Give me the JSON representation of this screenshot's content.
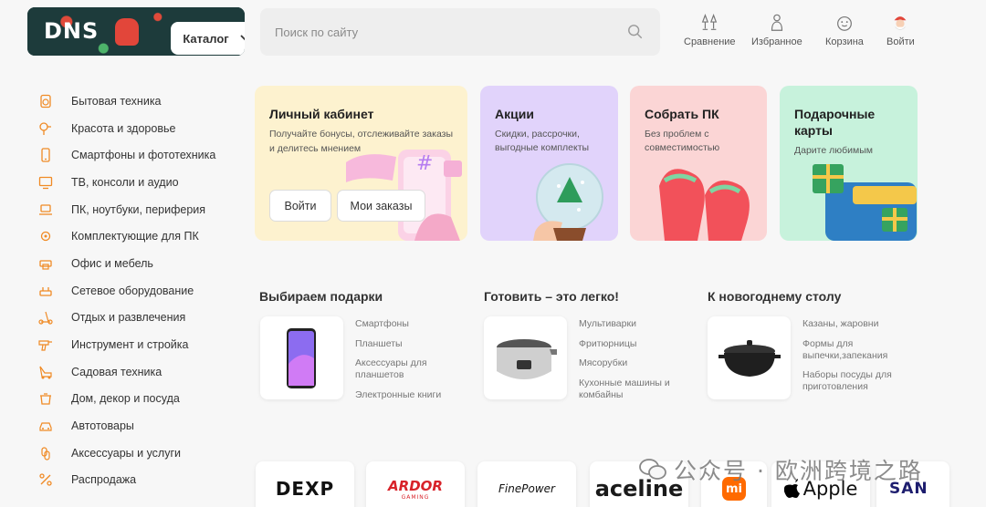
{
  "header": {
    "logo": "DNS",
    "catalog_label": "Каталог",
    "search_placeholder": "Поиск по сайту",
    "actions": [
      {
        "label": "Сравнение",
        "icon": "compare-icon"
      },
      {
        "label": "Избранное",
        "icon": "favorite-icon"
      },
      {
        "label": "Корзина",
        "icon": "cart-icon"
      },
      {
        "label": "Войти",
        "icon": "user-icon"
      }
    ]
  },
  "sidebar": {
    "items": [
      {
        "label": "Бытовая техника",
        "icon": "appliance-icon"
      },
      {
        "label": "Красота и здоровье",
        "icon": "hairdryer-icon"
      },
      {
        "label": "Смартфоны и фототехника",
        "icon": "smartphone-icon"
      },
      {
        "label": "ТВ, консоли и аудио",
        "icon": "tv-icon"
      },
      {
        "label": "ПК, ноутбуки, периферия",
        "icon": "laptop-icon"
      },
      {
        "label": "Комплектующие для ПК",
        "icon": "chip-icon"
      },
      {
        "label": "Офис и мебель",
        "icon": "printer-icon"
      },
      {
        "label": "Сетевое оборудование",
        "icon": "router-icon"
      },
      {
        "label": "Отдых и развлечения",
        "icon": "scooter-icon"
      },
      {
        "label": "Инструмент и стройка",
        "icon": "drill-icon"
      },
      {
        "label": "Садовая техника",
        "icon": "mower-icon"
      },
      {
        "label": "Дом, декор и посуда",
        "icon": "pot-icon"
      },
      {
        "label": "Автотовары",
        "icon": "car-icon"
      },
      {
        "label": "Аксессуары и услуги",
        "icon": "accessory-icon"
      },
      {
        "label": "Распродажа",
        "icon": "percent-icon"
      }
    ]
  },
  "promos": {
    "account": {
      "title": "Личный кабинет",
      "subtitle_1": "Получайте бонусы, отслеживайте заказы",
      "subtitle_2": "и делитесь мнением",
      "login_btn": "Войти",
      "orders_btn": "Мои заказы",
      "color": "#fdf3cf"
    },
    "sales": {
      "title": "Акции",
      "subtitle_1": "Скидки, рассрочки,",
      "subtitle_2": "выгодные комплекты",
      "color": "#e3d4fb"
    },
    "build_pc": {
      "title": "Собрать ПК",
      "subtitle_1": "Без проблем с",
      "subtitle_2": "совместимостью",
      "color": "#fbd6d6"
    },
    "gift_cards": {
      "title_1": "Подарочные",
      "title_2": "карты",
      "subtitle_1": "Дарите любимым",
      "color": "#c9f3dd"
    }
  },
  "sections": [
    {
      "title": "Выбираем подарки",
      "links": [
        "Смартфоны",
        "Планшеты",
        "Аксессуары для планшетов",
        "Электронные книги"
      ],
      "thumb_icon": "smartphone-thumb-icon"
    },
    {
      "title": "Готовить – это легко!",
      "links": [
        "Мультиварки",
        "Фритюрницы",
        "Мясорубки",
        "Кухонные машины и комбайны"
      ],
      "thumb_icon": "multicooker-thumb-icon"
    },
    {
      "title": "К новогоднему столу",
      "links": [
        "Казаны, жаровни",
        "Формы для выпечки,запекания",
        "Наборы посуды для приготовления"
      ],
      "thumb_icon": "cookware-thumb-icon"
    }
  ],
  "brands": [
    "DEXP",
    "ARDOR",
    "FinePower",
    "aceline",
    "mi",
    "Apple",
    "SAN"
  ],
  "brands_extra": {
    "ardor_sub": "GAMING"
  },
  "watermark": "公众号 · 欧洲跨境之路"
}
